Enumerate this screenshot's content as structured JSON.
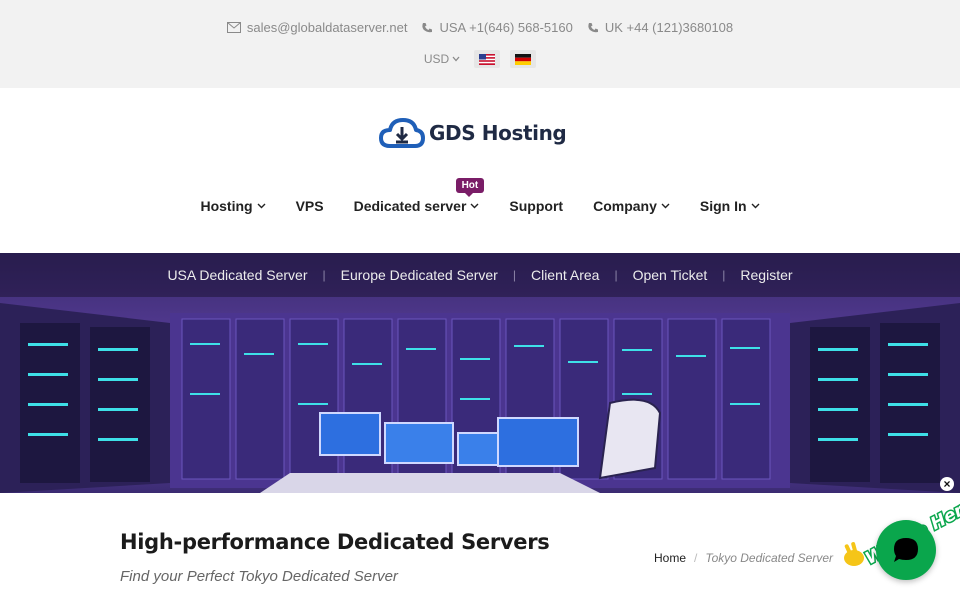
{
  "topbar": {
    "email": "sales@globaldataserver.net",
    "usa_phone": "USA +1(646) 568-5160",
    "uk_phone": "UK +44 (121)3680108",
    "currency": "USD"
  },
  "header": {
    "brand": "GDS Hosting"
  },
  "nav": {
    "items": [
      {
        "label": "Hosting",
        "dropdown": true
      },
      {
        "label": "VPS",
        "dropdown": false
      },
      {
        "label": "Dedicated server",
        "dropdown": true,
        "badge": "Hot"
      },
      {
        "label": "Support",
        "dropdown": false
      },
      {
        "label": "Company",
        "dropdown": true
      },
      {
        "label": "Sign In",
        "dropdown": true
      }
    ]
  },
  "subnav": {
    "items": [
      "USA Dedicated Server",
      "Europe Dedicated Server",
      "Client Area",
      "Open Ticket",
      "Register"
    ]
  },
  "page": {
    "title": "High-performance Dedicated Servers",
    "subtitle": "Find your Perfect Tokyo Dedicated Server"
  },
  "breadcrumb": {
    "home": "Home",
    "current": "Tokyo Dedicated Server"
  },
  "chat": {
    "label": "We Are Here!",
    "close": "×"
  },
  "colors": {
    "brand": "#1f2a44",
    "accent": "#7a1d67",
    "chat": "#0aa64c",
    "hero": "#5a3f9c"
  }
}
